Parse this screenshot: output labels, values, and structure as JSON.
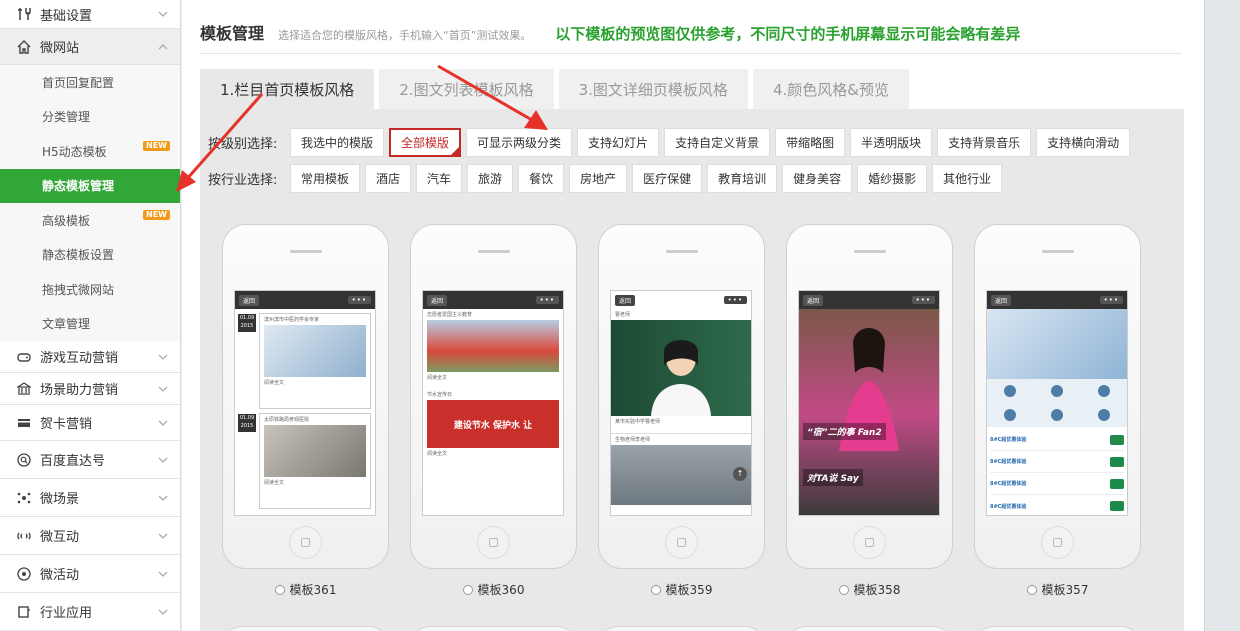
{
  "sidebar": {
    "groups_top": [
      {
        "label": "基础设置",
        "icon": "tools-icon"
      },
      {
        "label": "微网站",
        "icon": "home-icon"
      }
    ],
    "sub_items": [
      {
        "label": "首页回复配置"
      },
      {
        "label": "分类管理"
      },
      {
        "label": "H5动态模板",
        "badge": "NEW"
      },
      {
        "label": "静态模板管理"
      },
      {
        "label": "高级模板",
        "badge": "NEW"
      },
      {
        "label": "静态模板设置"
      },
      {
        "label": "拖拽式微网站"
      },
      {
        "label": "文章管理"
      }
    ],
    "groups_bottom": [
      {
        "label": "游戏互动营销",
        "icon": "gamepad-icon"
      },
      {
        "label": "场景助力营销",
        "icon": "bank-icon"
      },
      {
        "label": "贺卡营销",
        "icon": "card-icon"
      },
      {
        "label": "百度直达号",
        "icon": "search-circle-icon"
      },
      {
        "label": "微场景",
        "icon": "scene-icon"
      },
      {
        "label": "微互动",
        "icon": "interact-icon"
      },
      {
        "label": "微活动",
        "icon": "activity-icon"
      },
      {
        "label": "行业应用",
        "icon": "app-icon"
      }
    ]
  },
  "header": {
    "title": "模板管理",
    "subtitle": "选择适合您的模版风格，手机输入“首页”测试效果。",
    "notice": "以下模板的预览图仅供参考，不同尺寸的手机屏幕显示可能会略有差异"
  },
  "tabs": [
    {
      "label": "1.栏目首页模板风格"
    },
    {
      "label": "2.图文列表模板风格"
    },
    {
      "label": "3.图文详细页模板风格"
    },
    {
      "label": "4.颜色风格&预览"
    }
  ],
  "filters": {
    "level_label": "按级别选择:",
    "level_chips": [
      "我选中的模版",
      "全部模版",
      "可显示两级分类",
      "支持幻灯片",
      "支持自定义背景",
      "带缩略图",
      "半透明版块",
      "支持背景音乐",
      "支持横向滑动"
    ],
    "industry_label": "按行业选择:",
    "industry_chips": [
      "常用模板",
      "酒店",
      "汽车",
      "旅游",
      "餐饮",
      "房地产",
      "医疗保健",
      "教育培训",
      "健身美容",
      "婚纱摄影",
      "其他行业"
    ]
  },
  "templates": [
    {
      "label": "模板361"
    },
    {
      "label": "模板360"
    },
    {
      "label": "模板359"
    },
    {
      "label": "模板358"
    },
    {
      "label": "模板357"
    }
  ],
  "screen_text": {
    "back": "返回",
    "more": "•••",
    "t361_date": "01.09 2015",
    "t361_a": "滨州滨市中医药学会专家",
    "t361_b": "太原铁路局参观医院",
    "t361_read": "阅读全文",
    "t360_a": "志愿者爱国主义教育",
    "t360_b": "节水宣传日",
    "t360_banner": "建设节水 保护水 让",
    "t360_read": "阅读全文",
    "t359_a": "曹老师",
    "t359_b": "某市实验中学曹老师",
    "t359_c": "生物老师李老师",
    "t358_a": "“宿”二的事 Fan2",
    "t358_b": "对TA说 Say",
    "t357_item": "8#C超优惠体验"
  },
  "colors": {
    "active_green": "#32a738",
    "notice_green": "#2aa12f",
    "selected_red": "#c62828",
    "badge_orange": "#f29b1a"
  }
}
